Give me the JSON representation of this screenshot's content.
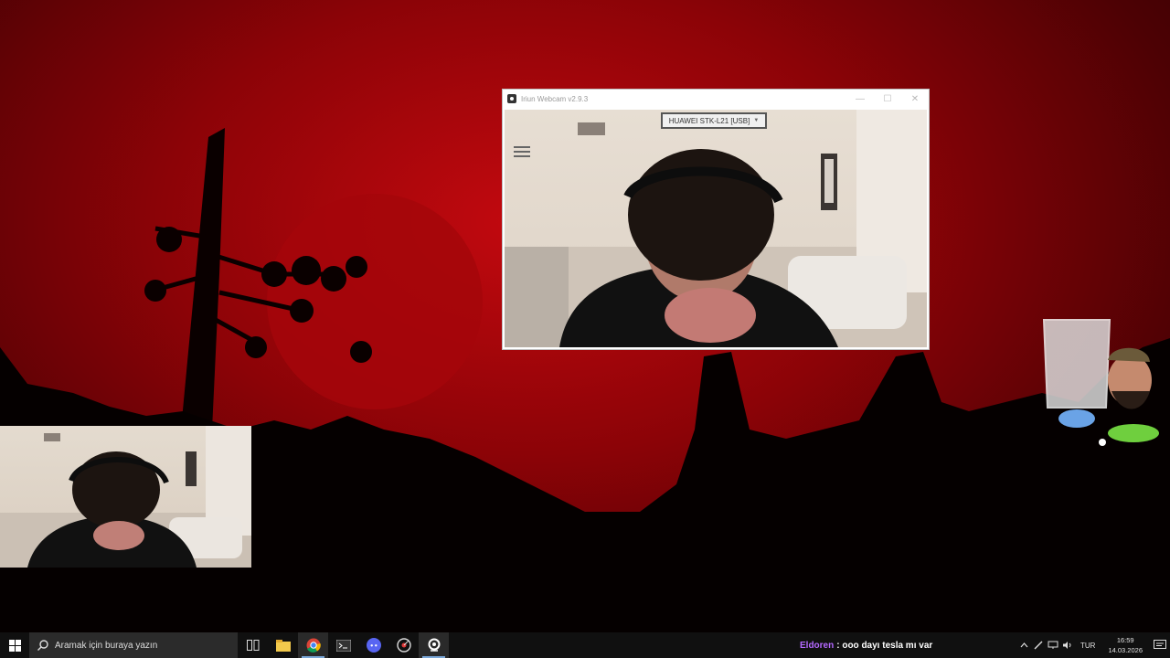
{
  "webcam_window": {
    "title": "Iriun Webcam v2.9.3",
    "device": "HUAWEI STK-L21 [USB]",
    "minimize": "—",
    "maximize": "☐",
    "close": "✕"
  },
  "taskbar": {
    "search_placeholder": "Aramak için buraya yazın",
    "chat_user": "Eldoren",
    "chat_message": ": ooo dayı tesla mı var",
    "language": "TUR",
    "time": "16:59",
    "date": "14.03.2026",
    "apps": [
      "task-view-icon",
      "file-explorer-icon",
      "chrome-icon",
      "terminal-icon",
      "discord-icon",
      "streaming-app-icon",
      "iriun-icon"
    ]
  },
  "colors": {
    "wallpaper_red": "#8c0307",
    "moon_red": "#b1060c",
    "taskbar": "#101010",
    "chat_user": "#b469ff"
  }
}
